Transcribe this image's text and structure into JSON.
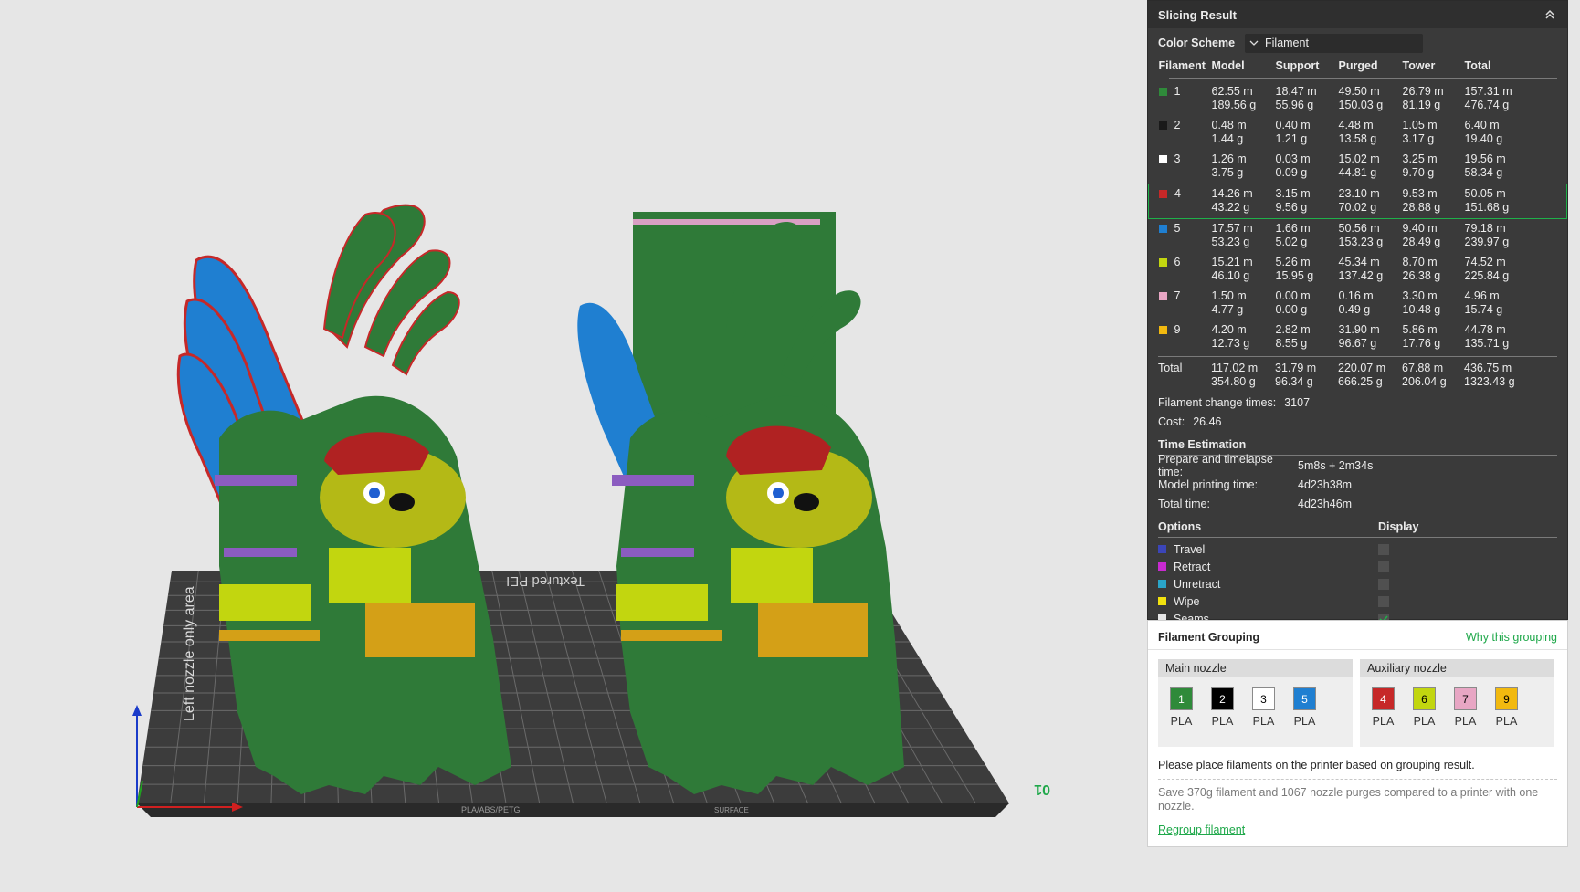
{
  "viewport": {
    "plate_text_left": "Left nozzle only area",
    "plate_text_top": "Textured PEI",
    "plate_text_bottom": "PLA/ABS/PETG",
    "plate_text_small": "SURFACE",
    "plate_number": "01"
  },
  "panel": {
    "title": "Slicing Result",
    "color_scheme_label": "Color Scheme",
    "color_scheme_value": "Filament",
    "columns": [
      "Filament",
      "Model",
      "Support",
      "Purged",
      "Tower",
      "Total"
    ],
    "rows": [
      {
        "id": "1",
        "color": "#2f8a3a",
        "model_m": "62.55 m",
        "model_g": "189.56 g",
        "support_m": "18.47 m",
        "support_g": "55.96 g",
        "purged_m": "49.50 m",
        "purged_g": "150.03 g",
        "tower_m": "26.79 m",
        "tower_g": "81.19 g",
        "total_m": "157.31 m",
        "total_g": "476.74 g"
      },
      {
        "id": "2",
        "color": "#1a1a1a",
        "model_m": "0.48 m",
        "model_g": "1.44 g",
        "support_m": "0.40 m",
        "support_g": "1.21 g",
        "purged_m": "4.48 m",
        "purged_g": "13.58 g",
        "tower_m": "1.05 m",
        "tower_g": "3.17 g",
        "total_m": "6.40 m",
        "total_g": "19.40 g"
      },
      {
        "id": "3",
        "color": "#ffffff",
        "model_m": "1.26 m",
        "model_g": "3.75 g",
        "support_m": "0.03 m",
        "support_g": "0.09 g",
        "purged_m": "15.02 m",
        "purged_g": "44.81 g",
        "tower_m": "3.25 m",
        "tower_g": "9.70 g",
        "total_m": "19.56 m",
        "total_g": "58.34 g"
      },
      {
        "id": "4",
        "color": "#c62828",
        "model_m": "14.26 m",
        "model_g": "43.22 g",
        "support_m": "3.15 m",
        "support_g": "9.56 g",
        "purged_m": "23.10 m",
        "purged_g": "70.02 g",
        "tower_m": "9.53 m",
        "tower_g": "28.88 g",
        "total_m": "50.05 m",
        "total_g": "151.68 g"
      },
      {
        "id": "5",
        "color": "#1f7fd1",
        "model_m": "17.57 m",
        "model_g": "53.23 g",
        "support_m": "1.66 m",
        "support_g": "5.02 g",
        "purged_m": "50.56 m",
        "purged_g": "153.23 g",
        "tower_m": "9.40 m",
        "tower_g": "28.49 g",
        "total_m": "79.18 m",
        "total_g": "239.97 g"
      },
      {
        "id": "6",
        "color": "#c2d60f",
        "model_m": "15.21 m",
        "model_g": "46.10 g",
        "support_m": "5.26 m",
        "support_g": "15.95 g",
        "purged_m": "45.34 m",
        "purged_g": "137.42 g",
        "tower_m": "8.70 m",
        "tower_g": "26.38 g",
        "total_m": "74.52 m",
        "total_g": "225.84 g"
      },
      {
        "id": "7",
        "color": "#e8a6c4",
        "model_m": "1.50 m",
        "model_g": "4.77 g",
        "support_m": "0.00 m",
        "support_g": "0.00 g",
        "purged_m": "0.16 m",
        "purged_g": "0.49 g",
        "tower_m": "3.30 m",
        "tower_g": "10.48 g",
        "total_m": "4.96 m",
        "total_g": "15.74 g"
      },
      {
        "id": "9",
        "color": "#f2b90f",
        "model_m": "4.20 m",
        "model_g": "12.73 g",
        "support_m": "2.82 m",
        "support_g": "8.55 g",
        "purged_m": "31.90 m",
        "purged_g": "96.67 g",
        "tower_m": "5.86 m",
        "tower_g": "17.76 g",
        "total_m": "44.78 m",
        "total_g": "135.71 g"
      }
    ],
    "total_row": {
      "label": "Total",
      "model_m": "117.02 m",
      "model_g": "354.80 g",
      "support_m": "31.79 m",
      "support_g": "96.34 g",
      "purged_m": "220.07 m",
      "purged_g": "666.25 g",
      "tower_m": "67.88 m",
      "tower_g": "206.04 g",
      "total_m": "436.75 m",
      "total_g": "1323.43 g"
    },
    "filament_change_label": "Filament change times:",
    "filament_change_value": "3107",
    "cost_label": "Cost:",
    "cost_value": "26.46",
    "time_title": "Time Estimation",
    "time_rows": [
      {
        "k": "Prepare and timelapse time:",
        "v": "5m8s + 2m34s"
      },
      {
        "k": "Model printing time:",
        "v": "4d23h38m"
      },
      {
        "k": "Total time:",
        "v": "4d23h46m"
      }
    ],
    "options_label": "Options",
    "display_label": "Display",
    "options": [
      {
        "label": "Travel",
        "color": "#3b45b8",
        "checked": false
      },
      {
        "label": "Retract",
        "color": "#c92ad1",
        "checked": false
      },
      {
        "label": "Unretract",
        "color": "#2aa5c9",
        "checked": false
      },
      {
        "label": "Wipe",
        "color": "#f2e20f",
        "checked": false
      },
      {
        "label": "Seams",
        "color": "#e6e6e6",
        "checked": true
      }
    ]
  },
  "grouping": {
    "title": "Filament Grouping",
    "why_link": "Why this grouping",
    "main_title": "Main nozzle",
    "aux_title": "Auxiliary nozzle",
    "main": [
      {
        "id": "1",
        "bg": "#2f8a3a",
        "fg": "#ffffff",
        "type": "PLA"
      },
      {
        "id": "2",
        "bg": "#000000",
        "fg": "#ffffff",
        "type": "PLA"
      },
      {
        "id": "3",
        "bg": "#ffffff",
        "fg": "#000000",
        "type": "PLA"
      },
      {
        "id": "5",
        "bg": "#1f7fd1",
        "fg": "#ffffff",
        "type": "PLA"
      }
    ],
    "aux": [
      {
        "id": "4",
        "bg": "#c62828",
        "fg": "#ffffff",
        "type": "PLA"
      },
      {
        "id": "6",
        "bg": "#c2d60f",
        "fg": "#000000",
        "type": "PLA"
      },
      {
        "id": "7",
        "bg": "#e8a6c4",
        "fg": "#000000",
        "type": "PLA"
      },
      {
        "id": "9",
        "bg": "#f2b90f",
        "fg": "#000000",
        "type": "PLA"
      }
    ],
    "note": "Please place filaments on the printer based on grouping result.",
    "save_text": "Save 370g filament and 1067 nozzle purges compared to a printer with one nozzle.",
    "regroup": "Regroup filament"
  }
}
